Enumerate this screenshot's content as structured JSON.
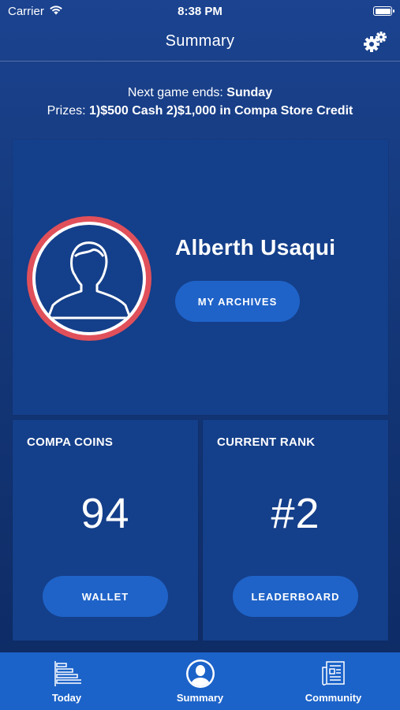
{
  "status_bar": {
    "carrier": "Carrier",
    "time": "8:38 PM"
  },
  "nav": {
    "title": "Summary",
    "settings_icon": "gears-icon"
  },
  "info": {
    "next_game_label": "Next game ends: ",
    "next_game_day": "Sunday",
    "prizes_label": "Prizes: ",
    "prizes_value": "1)$500 Cash 2)$1,000 in Compa Store Credit"
  },
  "profile": {
    "name": "Alberth Usaqui",
    "archives_button": "MY ARCHIVES",
    "avatar_icon": "user-silhouette-icon"
  },
  "coins": {
    "label": "COMPA COINS",
    "value": "94",
    "button": "WALLET"
  },
  "rank": {
    "label": "CURRENT RANK",
    "value": "#2",
    "button": "LEADERBOARD"
  },
  "tabs": [
    {
      "label": "Today",
      "icon": "bar-list-icon"
    },
    {
      "label": "Summary",
      "icon": "user-circle-icon"
    },
    {
      "label": "Community",
      "icon": "newspaper-icon"
    }
  ],
  "colors": {
    "background": "#15397c",
    "card": "#143f8a",
    "button": "#1f63c8",
    "avatar_ring": "#e0505a",
    "tab_bar": "#1c63c9"
  }
}
